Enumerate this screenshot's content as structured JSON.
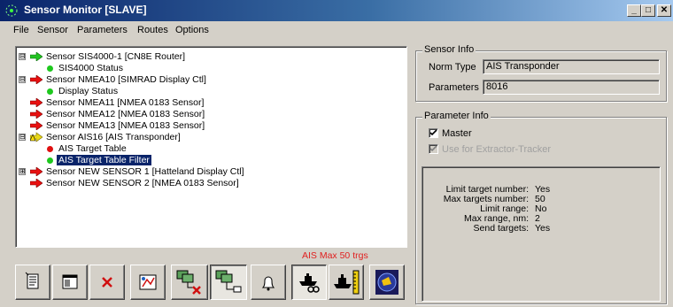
{
  "window": {
    "title": "Sensor Monitor [SLAVE]",
    "minimize": "_",
    "maximize": "□",
    "close": "✕"
  },
  "menu": [
    "File",
    "Sensor",
    "Parameters",
    "Routes",
    "Options"
  ],
  "tree": [
    {
      "label": "Sensor SIS4000-1 [CN8E Router]",
      "icon": "green-arrow-icon",
      "expander": "⊟"
    },
    {
      "label": "SIS4000 Status",
      "icon": "green-dot-icon"
    },
    {
      "label": "Sensor NMEA10 [SIMRAD Display Ctl]",
      "icon": "red-arrow-icon",
      "expander": "⊟"
    },
    {
      "label": "Display Status",
      "icon": "green-dot-icon"
    },
    {
      "label": "Sensor NMEA11 [NMEA 0183 Sensor]",
      "icon": "red-arrow-icon"
    },
    {
      "label": "Sensor NMEA12 [NMEA 0183 Sensor]",
      "icon": "red-arrow-icon"
    },
    {
      "label": "Sensor NMEA13 [NMEA 0183 Sensor]",
      "icon": "red-arrow-icon"
    },
    {
      "label": "Sensor AIS16 [AIS Transponder]",
      "icon": "warning-arrow-icon",
      "expander": "⊟"
    },
    {
      "label": "AIS Target Table",
      "icon": "red-dot-icon"
    },
    {
      "label": "AIS Target Table Filter",
      "icon": "green-dot-icon",
      "selected": true
    },
    {
      "label": "Sensor NEW SENSOR 1 [Hatteland Display Ctl]",
      "icon": "red-arrow-icon",
      "expander": "⊞"
    },
    {
      "label": "Sensor NEW SENSOR 2 [NMEA 0183 Sensor]",
      "icon": "red-arrow-icon"
    }
  ],
  "status": {
    "ais_max": "AIS Max 50 trgs"
  },
  "toolbar": [
    {
      "name": "new-sensor-button",
      "icon": "new-document-icon"
    },
    {
      "name": "sensor-properties-button",
      "icon": "properties-icon"
    },
    {
      "name": "delete-sensor-button",
      "icon": "delete-icon"
    },
    {
      "name": "route-config-button",
      "icon": "route-icon"
    },
    {
      "name": "disconnect-network-button",
      "icon": "network-disconnect-icon"
    },
    {
      "name": "connect-network-button",
      "icon": "network-connect-icon",
      "pressed": true
    },
    {
      "name": "alarm-button",
      "icon": "bell-icon"
    },
    {
      "name": "ship-search-button",
      "icon": "ship-search-icon",
      "pressed": true
    },
    {
      "name": "ship-scale-button",
      "icon": "ship-scale-icon"
    },
    {
      "name": "radar-view-button",
      "icon": "radar-icon"
    }
  ],
  "sensor_info": {
    "title": "Sensor Info",
    "norm_type_label": "Norm Type",
    "norm_type_value": "AIS Transponder",
    "parameters_label": "Parameters",
    "parameters_value": "8016"
  },
  "parameter_info": {
    "title": "Parameter Info",
    "master_label": "Master",
    "master_checked": true,
    "extractor_label": "Use for Extractor-Tracker",
    "extractor_checked": true,
    "rows": [
      {
        "key": "Limit target number:",
        "value": "Yes"
      },
      {
        "key": "Max targets number:",
        "value": "50"
      },
      {
        "key": "Limit range:",
        "value": "No"
      },
      {
        "key": "Max range, nm:",
        "value": "2"
      },
      {
        "key": "Send targets:",
        "value": "Yes"
      }
    ]
  },
  "colors": {
    "titlebar_start": "#0a246a",
    "titlebar_end": "#a6caf0",
    "status_red": "#e02020",
    "face": "#d4d0c8"
  }
}
